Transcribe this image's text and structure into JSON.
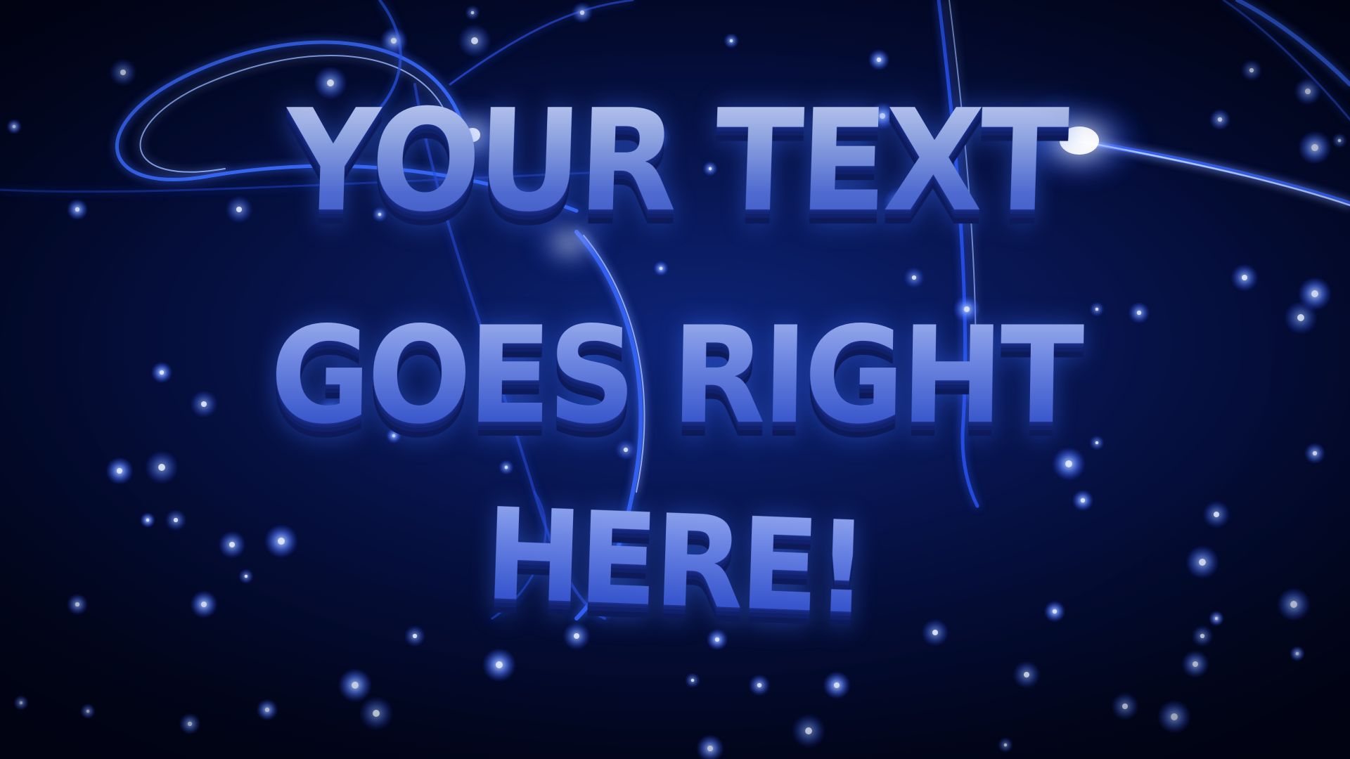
{
  "title_lines": [
    "YOUR TEXT",
    "GOES RIGHT",
    "HERE!"
  ],
  "colors": {
    "background_dark": "#02061a",
    "background_center": "#0d2478",
    "accent_blue": "#2f5bff",
    "glow": "#9fc0ff",
    "text_face": "#8ea3e0"
  }
}
